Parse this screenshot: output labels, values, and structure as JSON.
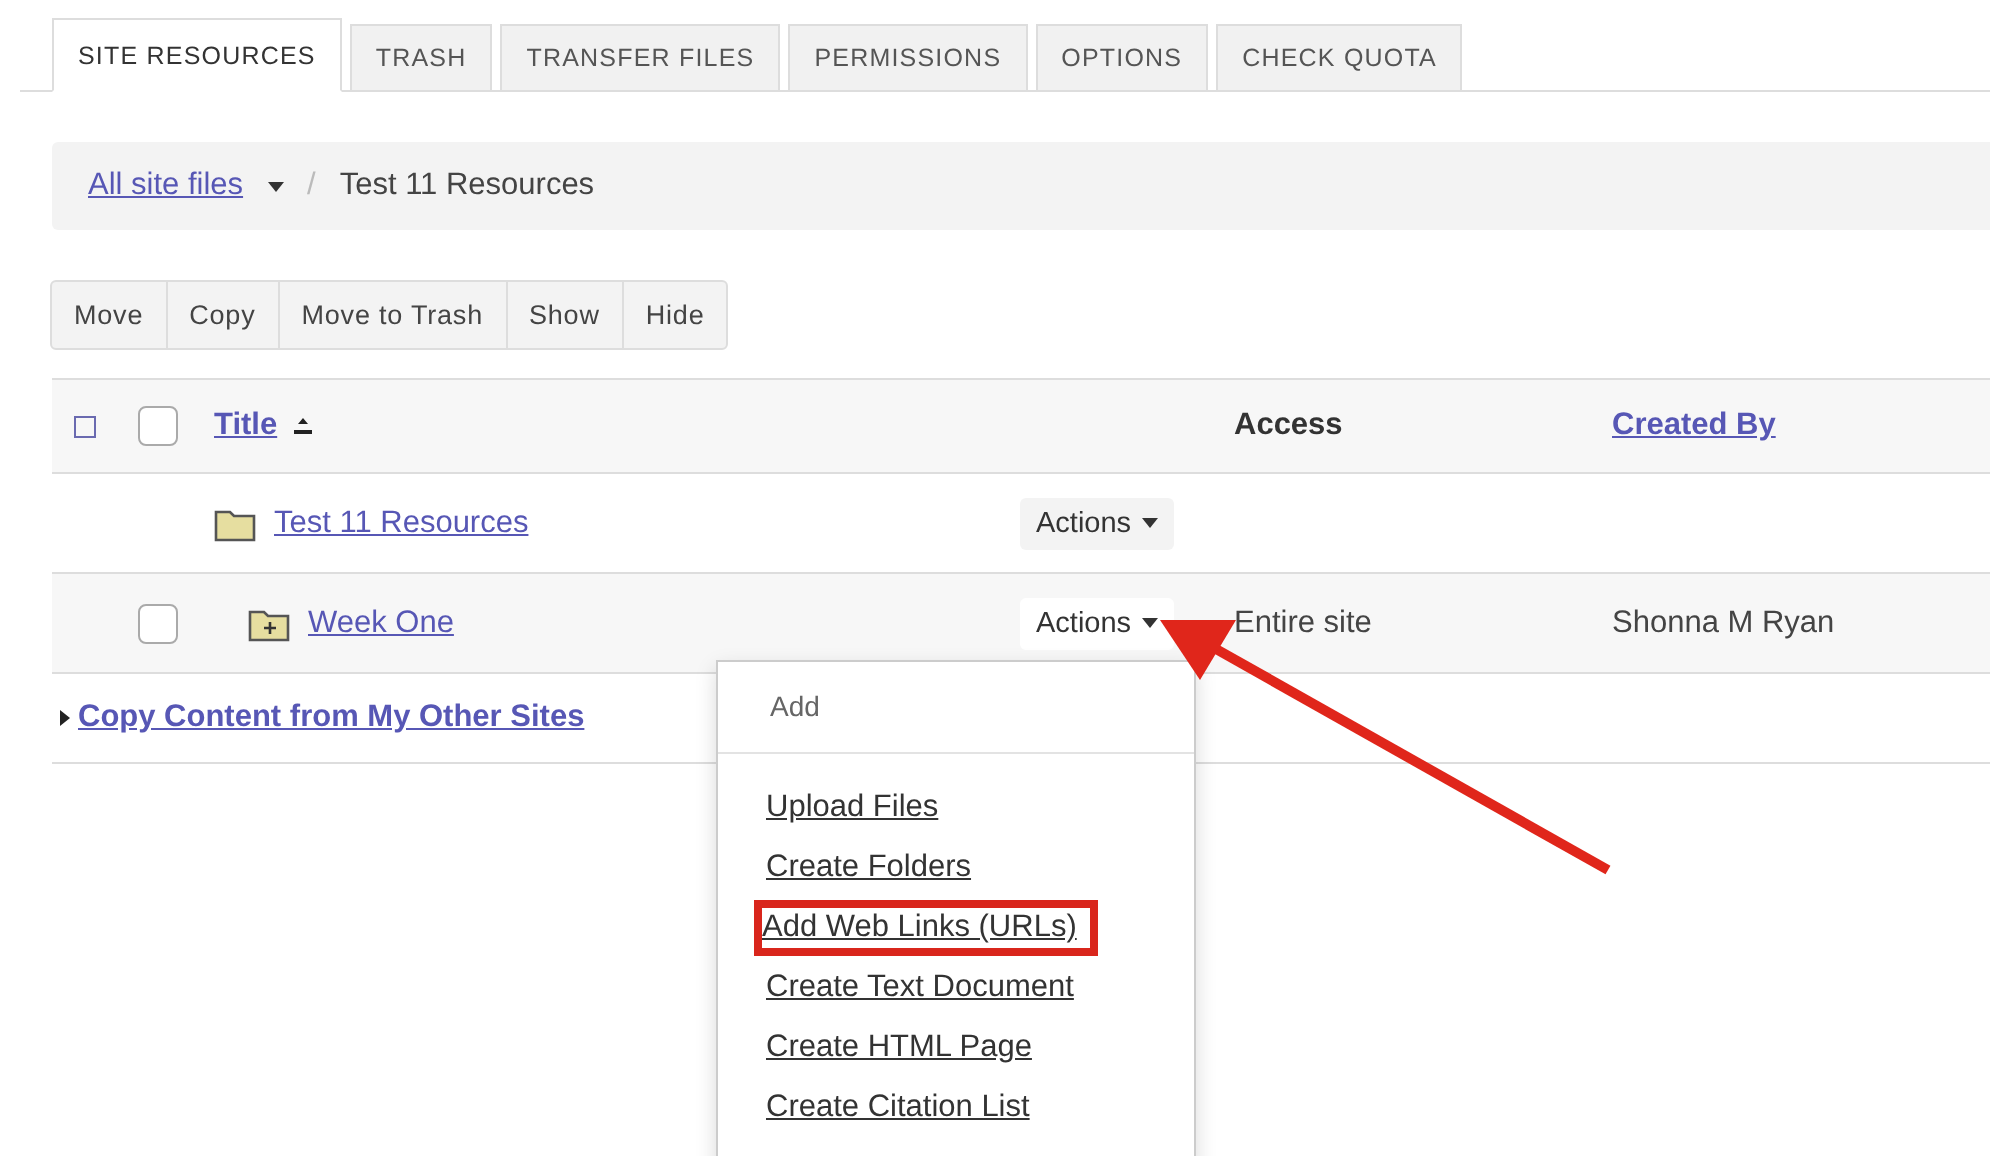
{
  "tabs": [
    {
      "label": "SITE RESOURCES",
      "selected": true
    },
    {
      "label": "TRASH",
      "selected": false
    },
    {
      "label": "TRANSFER FILES",
      "selected": false
    },
    {
      "label": "PERMISSIONS",
      "selected": false
    },
    {
      "label": "OPTIONS",
      "selected": false
    },
    {
      "label": "CHECK QUOTA",
      "selected": false
    }
  ],
  "breadcrumb": {
    "link": "All site files",
    "separator": "/",
    "current": "Test 11 Resources"
  },
  "toolbar_buttons": [
    "Move",
    "Copy",
    "Move to Trash",
    "Show",
    "Hide"
  ],
  "table": {
    "columns": {
      "title": "Title",
      "access": "Access",
      "created_by": "Created By"
    },
    "select_all_checked": false,
    "rows": [
      {
        "title": "Test 11 Resources",
        "actions": "Actions",
        "children": [
          {
            "title": "Week One",
            "actions": "Actions",
            "checked": false,
            "access": "Entire site",
            "created_by": "Shonna M Ryan"
          }
        ]
      }
    ]
  },
  "copy_link": "Copy Content from My Other Sites",
  "actions_menu": {
    "header": "Add",
    "items": [
      {
        "label": "Upload Files",
        "highlighted": false
      },
      {
        "label": "Create Folders",
        "highlighted": false
      },
      {
        "label": "Add Web Links (URLs)",
        "highlighted": true
      },
      {
        "label": "Create Text Document",
        "highlighted": false
      },
      {
        "label": "Create HTML Page",
        "highlighted": false
      },
      {
        "label": "Create Citation List",
        "highlighted": false
      }
    ]
  }
}
